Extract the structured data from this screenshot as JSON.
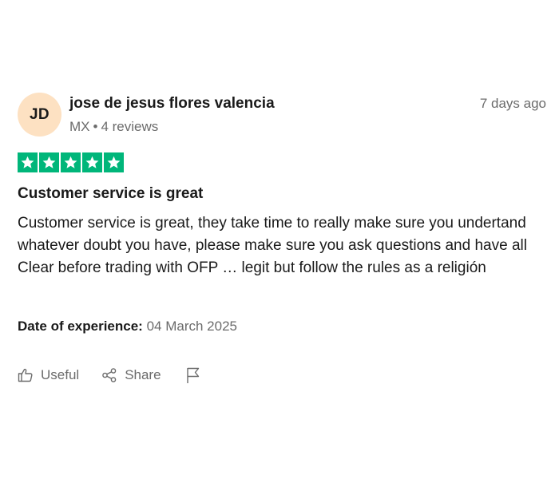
{
  "reviewer": {
    "initials": "JD",
    "name": "jose de jesus flores valencia",
    "country": "MX",
    "separator": "•",
    "review_count": "4 reviews",
    "avatar_color": "#fde1c2"
  },
  "review": {
    "posted": "7 days ago",
    "rating": 5,
    "max_rating": 5,
    "star_color": "#00b67a",
    "title": "Customer service is great",
    "body": "Customer service is great, they take time to really make sure you undertand whatever doubt you have, please make sure you ask questions and have all Clear before trading with OFP … legit but follow the rules as a religión",
    "experience_label": "Date of experience:",
    "experience_date": "04 March 2025"
  },
  "actions": {
    "useful_label": "Useful",
    "useful_icon": "thumbs-up-icon",
    "share_label": "Share",
    "share_icon": "share-icon",
    "report_icon": "flag-icon"
  }
}
